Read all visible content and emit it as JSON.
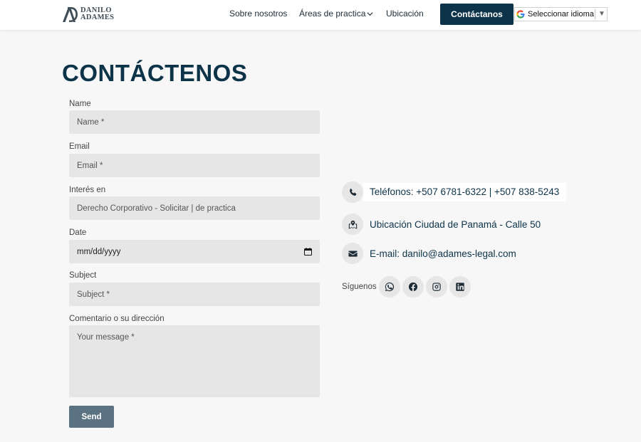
{
  "header": {
    "logo": {
      "line1": "DANILO",
      "line2": "ADAMES"
    },
    "nav": [
      {
        "label": "Sobre nosotros"
      },
      {
        "label": "Áreas de practica"
      },
      {
        "label": "Ubicación"
      }
    ],
    "cta_label": "Contáctanos",
    "language_selector": "Seleccionar idioma",
    "language_arrow": "▼"
  },
  "page_title": "CONTÁCTENOS",
  "form": {
    "name": {
      "label": "Name",
      "placeholder": "Name *"
    },
    "email": {
      "label": "Email",
      "placeholder": "Email *"
    },
    "interest": {
      "label": "Interés en",
      "value": "Derecho Corporativo - Solicitar | de practica"
    },
    "date": {
      "label": "Date",
      "placeholder": "mm/dd/yyyy"
    },
    "subject": {
      "label": "Subject",
      "placeholder": "Subject *"
    },
    "comment": {
      "label": "Comentario o su dirección",
      "placeholder": "Your message *"
    },
    "send_label": "Send"
  },
  "contact": {
    "phone": "Teléfonos: +507 6781-6322 | +507 838-5243",
    "location": "Ubicación Ciudad de Panamá - Calle 50",
    "email": "E-mail: danilo@adames-legal.com",
    "follow_label": "Síguenos",
    "socials": [
      "whatsapp-icon",
      "facebook-icon",
      "instagram-icon",
      "linkedin-icon"
    ]
  },
  "colors": {
    "brand": "#0d3349",
    "send_button": "#5a7282",
    "field_bg": "#e6e6e6",
    "page_bg": "#f7f7f7"
  }
}
